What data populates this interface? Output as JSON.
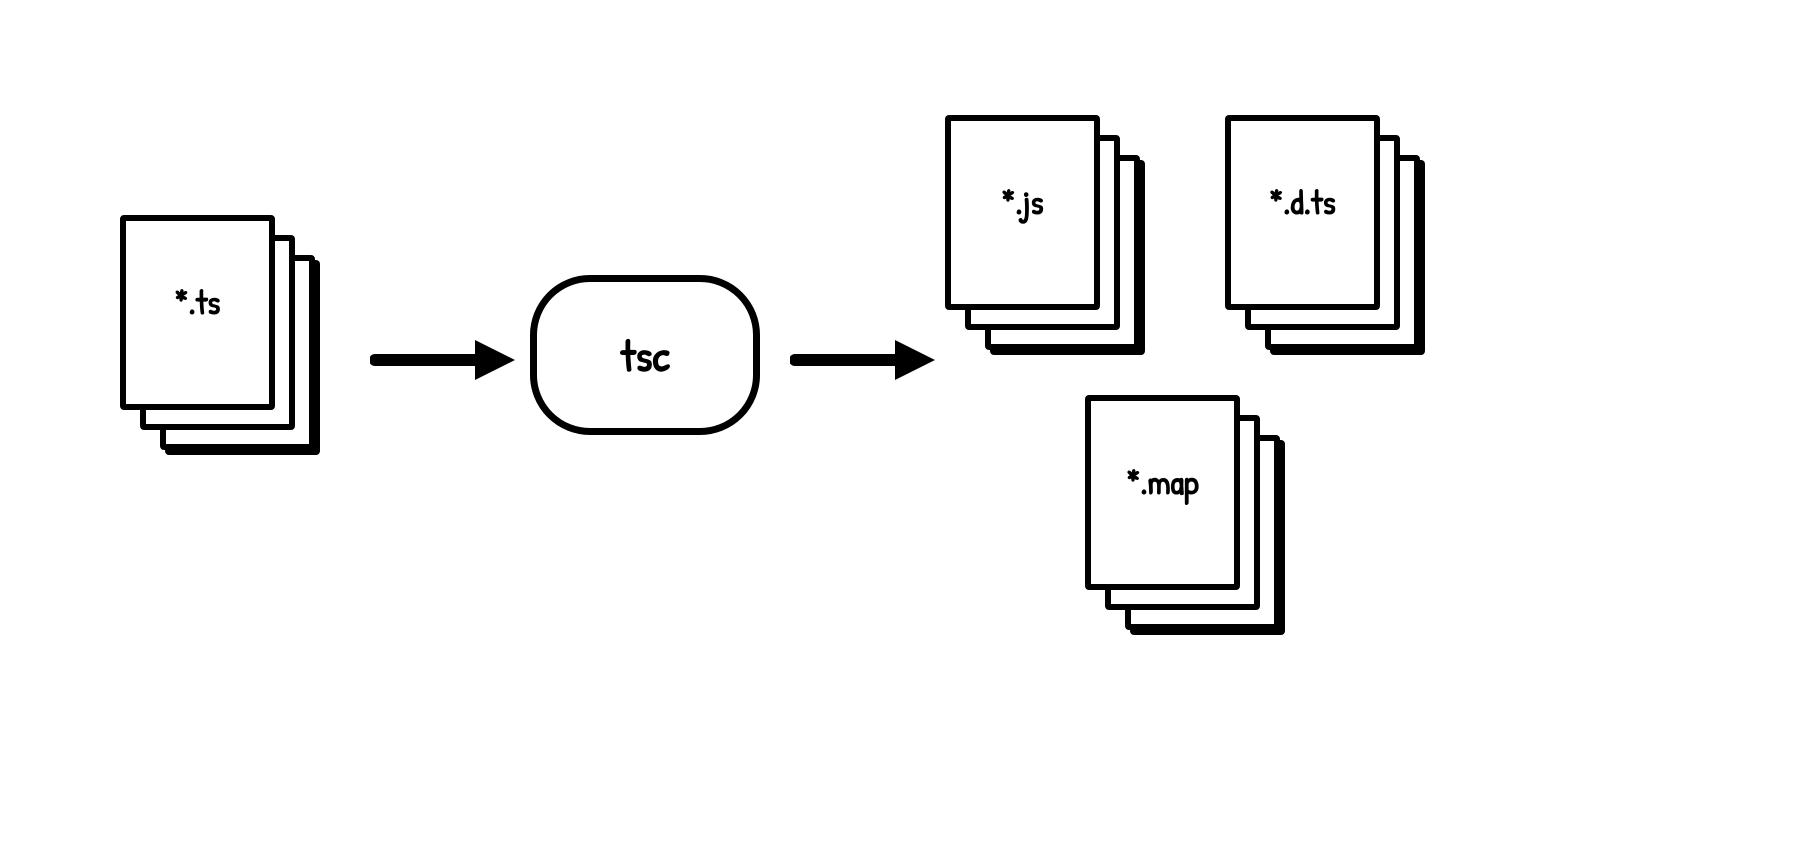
{
  "diagram": {
    "input": {
      "label": "*.ts"
    },
    "processor": {
      "label": "tsc"
    },
    "outputs": {
      "js": {
        "label": "*.js"
      },
      "dts": {
        "label": "*.d.ts"
      },
      "map": {
        "label": "*.map"
      }
    }
  }
}
